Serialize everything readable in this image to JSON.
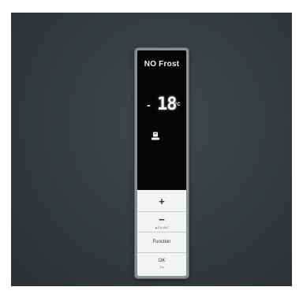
{
  "display": {
    "brand": "NO Frost",
    "temperature": {
      "sign": "-",
      "value": "18",
      "unit": "°C"
    },
    "mode_icon": "fridge-mode-icon"
  },
  "buttons": [
    {
      "label": "+",
      "sublabel": ""
    },
    {
      "label": "−",
      "sublabel": "▲3 s VAC"
    },
    {
      "label": "Function",
      "sublabel": ""
    },
    {
      "label": "OK",
      "sublabel": "3 s"
    }
  ],
  "colors": {
    "door": "#343b3d",
    "display_bg": "#050505",
    "segment": "#f4f4f4",
    "button_bg": "#f2f3f3"
  }
}
